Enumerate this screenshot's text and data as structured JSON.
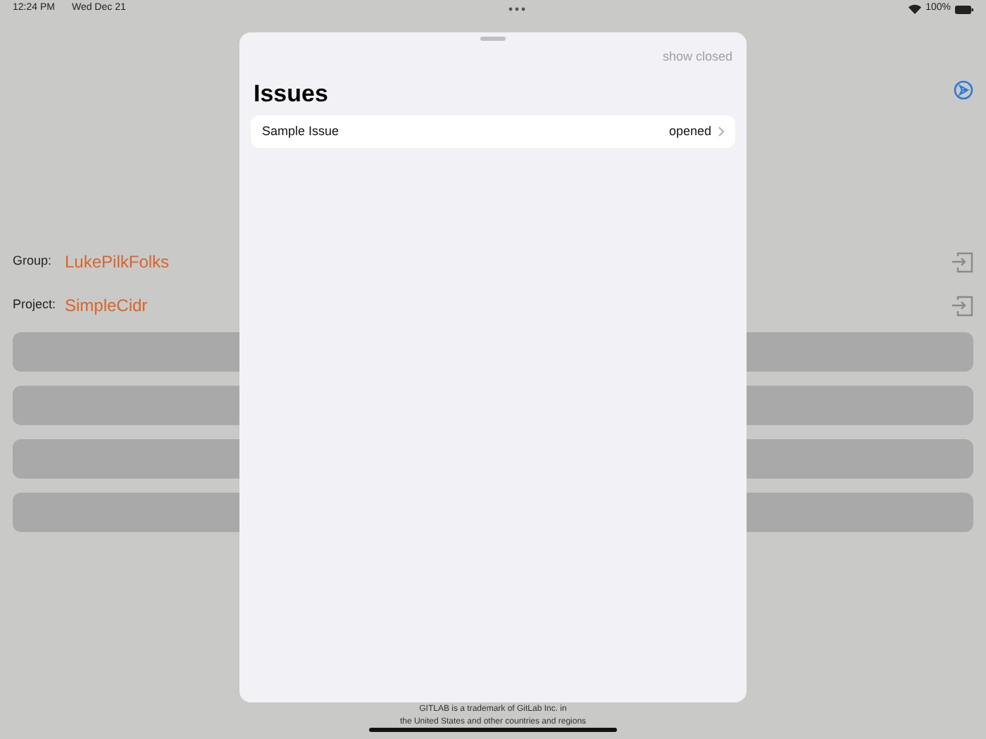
{
  "status_bar": {
    "time": "12:24 PM",
    "date": "Wed Dec 21",
    "battery": "100%"
  },
  "settings": [
    {
      "label": "Group:",
      "value": "LukePilkFolks"
    },
    {
      "label": "Project:",
      "value": "SimpleCidr"
    }
  ],
  "footer": {
    "line_1": "GITLAB is a trademark of GitLab Inc. in",
    "line_2": "the United States and other countries and regions"
  },
  "sheet": {
    "action": "show closed",
    "title": "Issues",
    "issues": [
      {
        "title": "Sample Issue",
        "state": "opened"
      }
    ]
  }
}
